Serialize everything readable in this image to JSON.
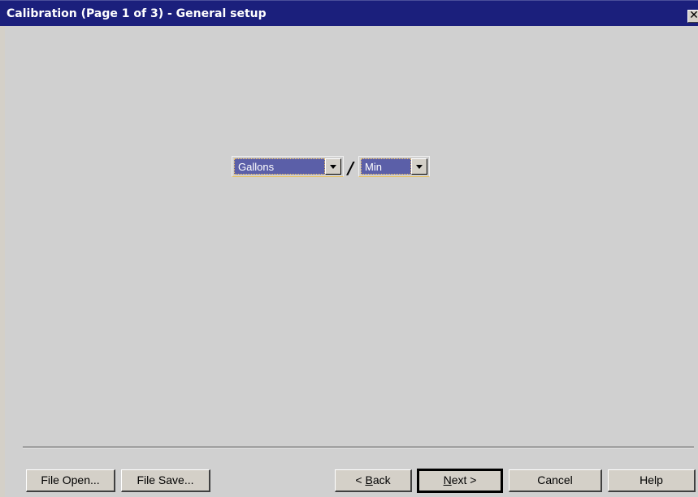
{
  "window": {
    "title": "Calibration (Page 1 of 3) - General setup",
    "close_glyph": "✕"
  },
  "units": {
    "volume": {
      "selected": "Gallons"
    },
    "separator": "/",
    "time": {
      "selected": "Min"
    }
  },
  "buttons": {
    "file_open": "File Open...",
    "file_save": "File Save...",
    "back_prefix": "< ",
    "back_mnemonic": "B",
    "back_rest": "ack",
    "next_mnemonic": "N",
    "next_rest": "ext >",
    "cancel": "Cancel",
    "help": "Help"
  },
  "colors": {
    "titlebar": "#1b1f7c",
    "selection": "#5b5fa8",
    "face": "#d4d0c8"
  },
  "icons": {
    "close": "close-icon",
    "dropdown": "chevron-down-icon"
  }
}
